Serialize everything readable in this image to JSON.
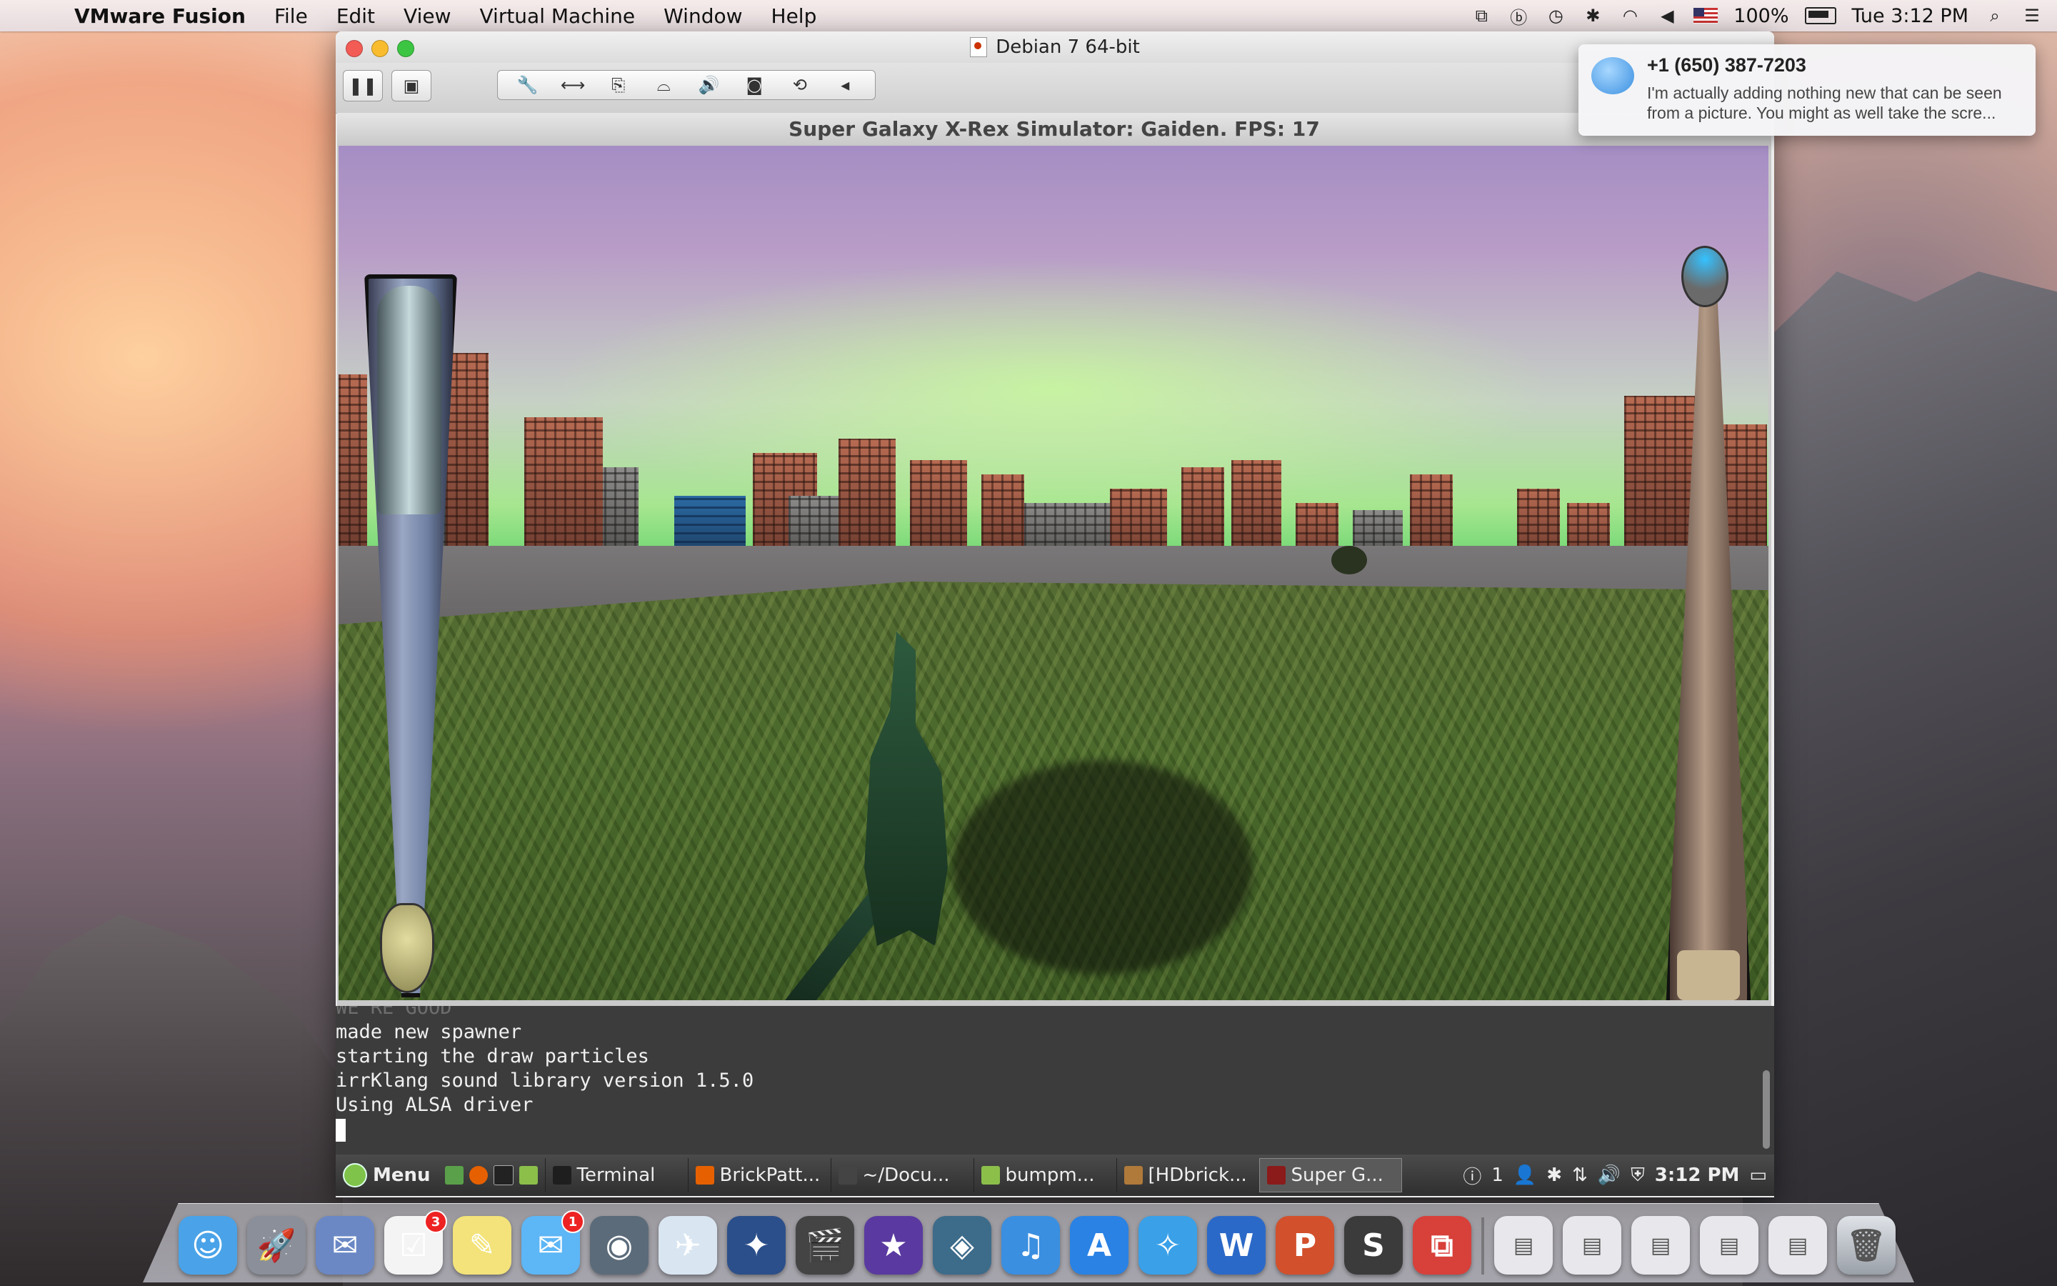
{
  "menubar": {
    "app_name": "VMware Fusion",
    "menus": [
      "File",
      "Edit",
      "View",
      "Virtual Machine",
      "Window",
      "Help"
    ],
    "battery": "100%",
    "clock": "Tue 3:12 PM",
    "status_icons": [
      "vmware-icon",
      "beats-icon",
      "time-machine-icon",
      "bluetooth-icon",
      "wifi-icon",
      "volume-icon",
      "us-flag-icon",
      "battery-icon",
      "spotlight-icon",
      "notification-center-icon"
    ]
  },
  "vm_window": {
    "title": "Debian 7 64-bit",
    "toolbar_icons": [
      "pause-icon",
      "snapshot-icon",
      "settings-wrench-icon",
      "network-icon",
      "usb-icon",
      "disk-icon",
      "sound-icon",
      "camera-icon",
      "sync-icon",
      "collapse-arrow-icon"
    ]
  },
  "game": {
    "title": "Super Galaxy X-Rex Simulator: Gaiden. FPS: 17",
    "left_meter_level": 0.32,
    "right_meter_level": 0.07
  },
  "terminal": {
    "ghost_line": "WE'RE GOOD",
    "lines": [
      "made new spawner",
      "starting the draw particles",
      "irrKlang sound library version 1.5.0",
      "Using ALSA driver"
    ]
  },
  "panel": {
    "menu_label": "Menu",
    "tasks": [
      {
        "label": "Terminal",
        "icon": "terminal-icon",
        "color": "#1e1e1e",
        "active": false
      },
      {
        "label": "BrickPatt...",
        "icon": "firefox-icon",
        "color": "#e66000",
        "active": false
      },
      {
        "label": "~/Docu...",
        "icon": "editor-icon",
        "color": "#444444",
        "active": false
      },
      {
        "label": "bumpm...",
        "icon": "folder-icon",
        "color": "#8bbf4a",
        "active": false
      },
      {
        "label": "[HDbrick...",
        "icon": "gimp-icon",
        "color": "#b07a3a",
        "active": false
      },
      {
        "label": "Super G...",
        "icon": "game-icon",
        "color": "#8b1a1a",
        "active": true
      }
    ],
    "workspace": "1",
    "clock": "3:12 PM"
  },
  "notification": {
    "sender": "+1 (650) 387-7203",
    "message": "I'm actually adding nothing new that can be seen from a picture. You might as well take the scre..."
  },
  "dock": {
    "apps": [
      {
        "name": "finder-icon",
        "color": "#4aa3e8",
        "glyph": "☺"
      },
      {
        "name": "launchpad-icon",
        "color": "#8a8f99",
        "glyph": "🚀"
      },
      {
        "name": "mail-icon",
        "color": "#6b88c5",
        "glyph": "✉"
      },
      {
        "name": "reminders-icon",
        "color": "#f4f4f4",
        "glyph": "☑",
        "badge": "3"
      },
      {
        "name": "stickies-icon",
        "color": "#f3e37a",
        "glyph": "✎"
      },
      {
        "name": "messages-icon",
        "color": "#5db6f5",
        "glyph": "✉",
        "badge": "1"
      },
      {
        "name": "facetime-icon",
        "color": "#5b6b7a",
        "glyph": "◉"
      },
      {
        "name": "preview-icon",
        "color": "#d9e6f2",
        "glyph": "✈"
      },
      {
        "name": "starcraft-icon",
        "color": "#2b4f8a",
        "glyph": "✦"
      },
      {
        "name": "final-cut-icon",
        "color": "#444444",
        "glyph": "🎬"
      },
      {
        "name": "imovie-icon",
        "color": "#5a3aa0",
        "glyph": "★"
      },
      {
        "name": "iphoto-icon",
        "color": "#3d6b8a",
        "glyph": "◈"
      },
      {
        "name": "itunes-icon",
        "color": "#3a8fe0",
        "glyph": "♫"
      },
      {
        "name": "app-store-icon",
        "color": "#2a82e4",
        "glyph": "A"
      },
      {
        "name": "safari-icon",
        "color": "#3aa0e8",
        "glyph": "✧"
      },
      {
        "name": "word-icon",
        "color": "#2b69c8",
        "glyph": "W"
      },
      {
        "name": "powerpoint-icon",
        "color": "#d2502c",
        "glyph": "P"
      },
      {
        "name": "sublime-icon",
        "color": "#3b3b3b",
        "glyph": "S"
      },
      {
        "name": "vmware-fusion-icon",
        "color": "#d8403a",
        "glyph": "⧉"
      }
    ],
    "docs": [
      "document-word-icon",
      "document-preview-icon",
      "document-terminal-icon",
      "document-web-icon",
      "document-finder-icon"
    ],
    "trash": "trash-icon"
  }
}
